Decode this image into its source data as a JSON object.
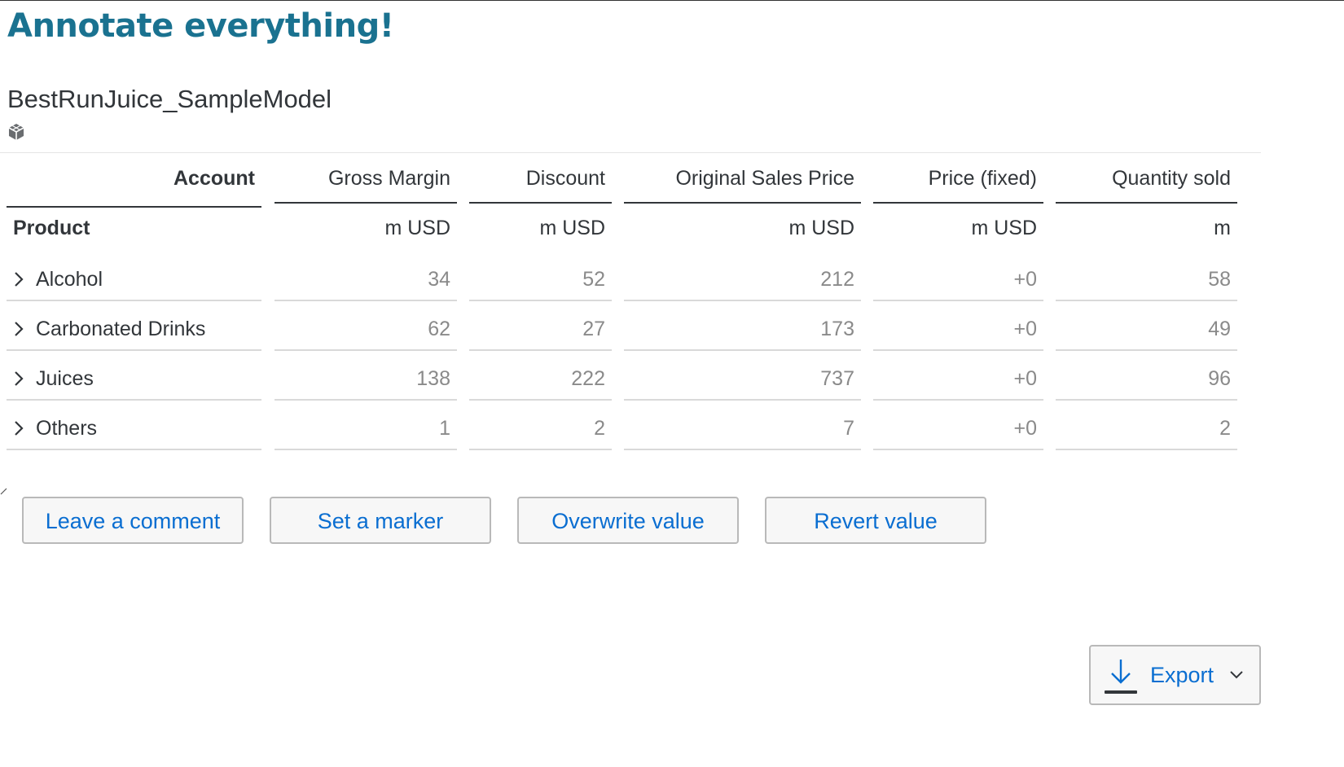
{
  "page": {
    "title": "Annotate everything!"
  },
  "model": {
    "name": "BestRunJuice_SampleModel",
    "icon": "cube-icon"
  },
  "table": {
    "account_header": "Account",
    "product_label": "Product",
    "columns": [
      {
        "name": "Gross Margin",
        "unit": "m USD"
      },
      {
        "name": "Discount",
        "unit": "m USD"
      },
      {
        "name": "Original Sales Price",
        "unit": "m USD"
      },
      {
        "name": "Price (fixed)",
        "unit": "m USD"
      },
      {
        "name": "Quantity sold",
        "unit": "m"
      }
    ],
    "rows": [
      {
        "product": "Alcohol",
        "values": [
          "34",
          "52",
          "212",
          "+0",
          "58"
        ]
      },
      {
        "product": "Carbonated Drinks",
        "values": [
          "62",
          "27",
          "173",
          "+0",
          "49"
        ]
      },
      {
        "product": "Juices",
        "values": [
          "138",
          "222",
          "737",
          "+0",
          "96"
        ]
      },
      {
        "product": "Others",
        "values": [
          "1",
          "2",
          "7",
          "+0",
          "2"
        ]
      }
    ]
  },
  "actions": {
    "leave_comment": "Leave a comment",
    "set_marker": "Set a marker",
    "overwrite_value": "Overwrite value",
    "revert_value": "Revert value"
  },
  "export": {
    "label": "Export",
    "icon": "download-icon"
  },
  "colors": {
    "title": "#1a7290",
    "button_text": "#0a6ed1",
    "text": "#32363a",
    "value_text": "#8a8a8a"
  }
}
